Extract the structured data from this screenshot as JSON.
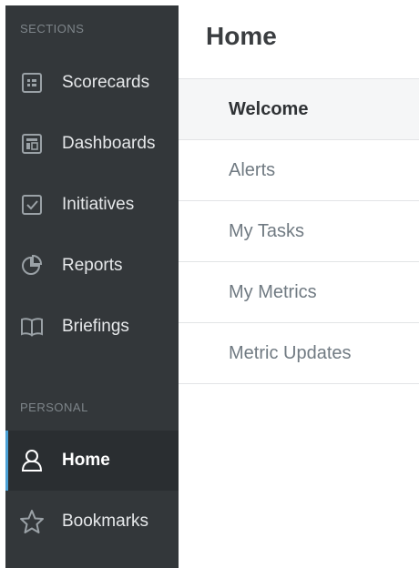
{
  "sidebar": {
    "sections_heading": "SECTIONS",
    "sections": [
      {
        "label": "Scorecards",
        "icon": "scorecard-icon"
      },
      {
        "label": "Dashboards",
        "icon": "dashboard-icon"
      },
      {
        "label": "Initiatives",
        "icon": "checkbox-icon"
      },
      {
        "label": "Reports",
        "icon": "pie-chart-icon"
      },
      {
        "label": "Briefings",
        "icon": "book-icon"
      }
    ],
    "personal_heading": "PERSONAL",
    "personal": [
      {
        "label": "Home",
        "icon": "user-icon",
        "active": true
      },
      {
        "label": "Bookmarks",
        "icon": "star-icon"
      }
    ]
  },
  "main": {
    "title": "Home",
    "items": [
      {
        "label": "Welcome",
        "selected": true
      },
      {
        "label": "Alerts"
      },
      {
        "label": "My Tasks"
      },
      {
        "label": "My Metrics"
      },
      {
        "label": "Metric Updates"
      }
    ]
  },
  "colors": {
    "sidebar_bg": "#33373a",
    "sidebar_active_bg": "#2a2e31",
    "accent": "#4aa0d5"
  }
}
